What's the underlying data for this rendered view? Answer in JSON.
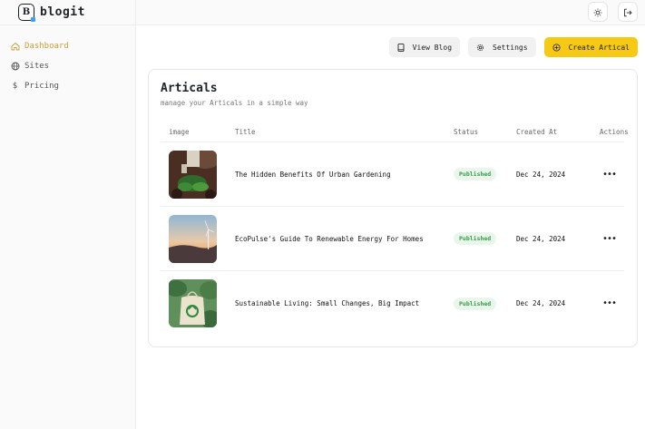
{
  "brand": {
    "name": "blogit",
    "logo_letter": "B"
  },
  "sidebar": {
    "items": [
      {
        "label": "Dashboard",
        "icon": "home-icon",
        "active": true
      },
      {
        "label": "Sites",
        "icon": "globe-icon",
        "active": false
      },
      {
        "label": "Pricing",
        "icon": "dollar-icon",
        "active": false
      }
    ]
  },
  "topbar": {
    "theme_icon": "sun-icon",
    "logout_icon": "logout-icon"
  },
  "toolbar": {
    "view_blog_label": "View Blog",
    "settings_label": "Settings",
    "create_label": "Create Artical"
  },
  "colors": {
    "accent": "#f6c915",
    "active_nav": "#c9a23a",
    "published": "#2f9e44"
  },
  "articles": {
    "title": "Articals",
    "subtitle": "manage your Articals in a simple way",
    "headers": {
      "image": "image",
      "title": "Title",
      "status": "Status",
      "created": "Created At",
      "actions": "Actions"
    },
    "rows": [
      {
        "title": "The Hidden Benefits Of Urban Gardening",
        "status": "Published",
        "created": "Dec 24, 2024",
        "actions": "•••"
      },
      {
        "title": "EcoPulse's Guide To Renewable Energy For Homes",
        "status": "Published",
        "created": "Dec 24, 2024",
        "actions": "•••"
      },
      {
        "title": "Sustainable Living: Small Changes, Big Impact",
        "status": "Published",
        "created": "Dec 24, 2024",
        "actions": "•••"
      }
    ]
  }
}
